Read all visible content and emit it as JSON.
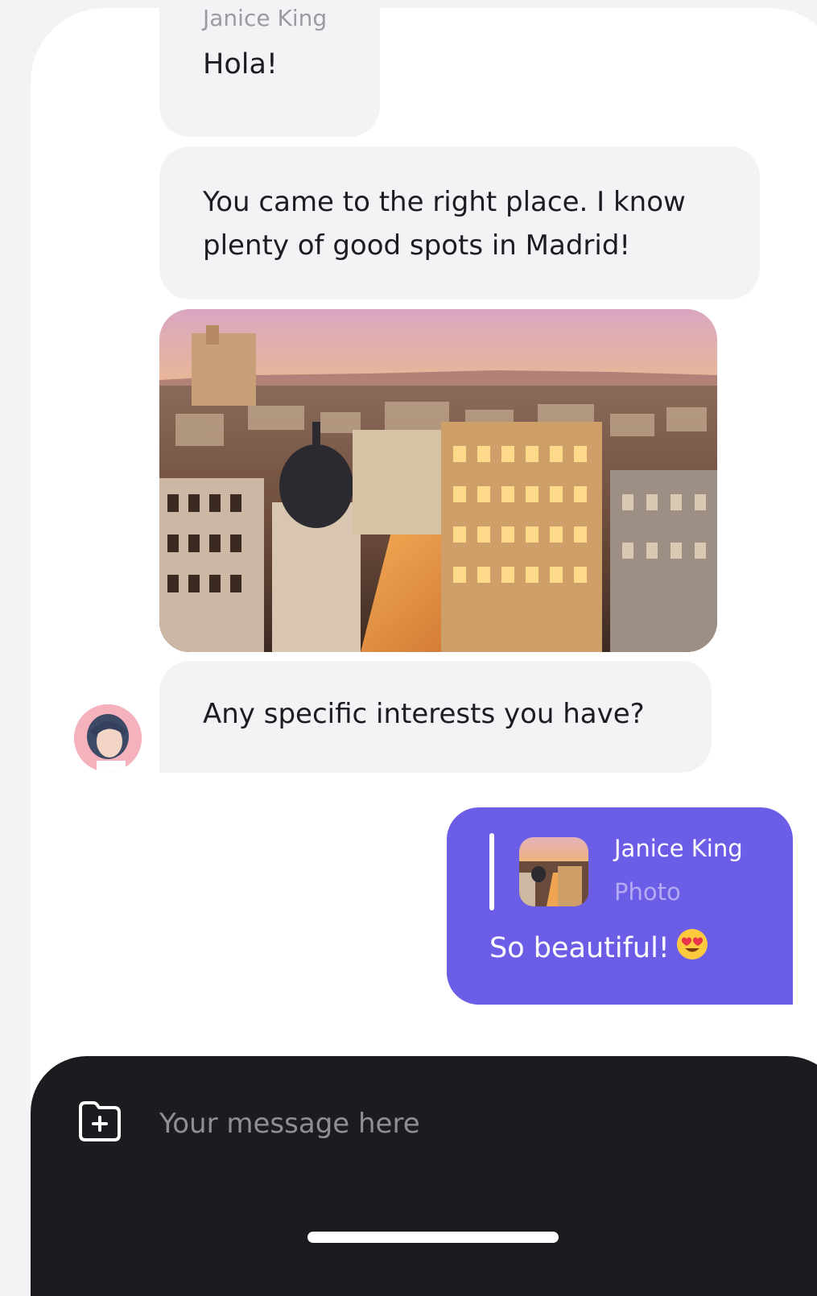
{
  "messages": {
    "greeting": {
      "sender": "Janice King",
      "text": "Hola!"
    },
    "intro": {
      "text": "You came to the right place. I know plenty of good spots in Madrid!"
    },
    "photo": {
      "icon": "city-photo"
    },
    "question": {
      "text": "Any specific interests you have?"
    }
  },
  "reply": {
    "quoted_sender": "Janice King",
    "quoted_type": "Photo",
    "text": "So beautiful!",
    "emoji": "heart-eyes-emoji"
  },
  "composer": {
    "placeholder": "Your message here",
    "attach_icon": "folder-plus-icon"
  },
  "colors": {
    "accent": "#6b5de6",
    "bubble": "#f3f3f5",
    "composer": "#1c1c20"
  }
}
